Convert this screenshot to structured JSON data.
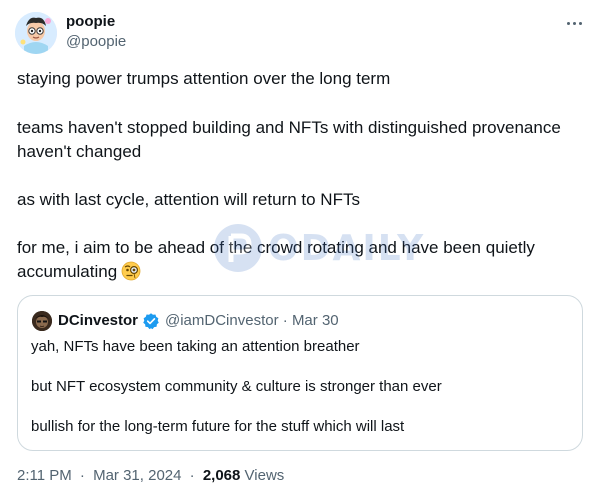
{
  "author": {
    "display_name": "poopie",
    "handle": "@poopie"
  },
  "body": {
    "lines": [
      "staying power trumps attention over the long term",
      "teams haven't stopped building and NFTs with distinguished provenance",
      "haven't changed",
      "as with last cycle, attention will return to NFTs",
      "for me, i aim to be ahead of the crowd rotating and have been quietly",
      "accumulating"
    ],
    "emoji": "face-with-monocle"
  },
  "watermark": {
    "text": "ODAILY"
  },
  "quoted_tweet": {
    "display_name": "DCinvestor",
    "handle": "@iamDCinvestor",
    "separator": "·",
    "date": "Mar 30",
    "verified": true,
    "badge_color": "#1d9bf0",
    "lines": [
      "yah, NFTs have been taking an attention breather",
      "but NFT ecosystem community & culture is stronger than ever",
      "bullish for the long-term future for the stuff which will last"
    ]
  },
  "meta": {
    "time": "2:11 PM",
    "separator": "·",
    "date": "Mar 31, 2024",
    "views_count": "2,068",
    "views_label": "Views"
  },
  "icons": {
    "more": "more-horizontal-icon",
    "verified": "verified-badge-icon"
  },
  "colors": {
    "text_primary": "#0f1419",
    "text_secondary": "#536471",
    "border": "#cfd9de",
    "verified": "#1d9bf0"
  }
}
